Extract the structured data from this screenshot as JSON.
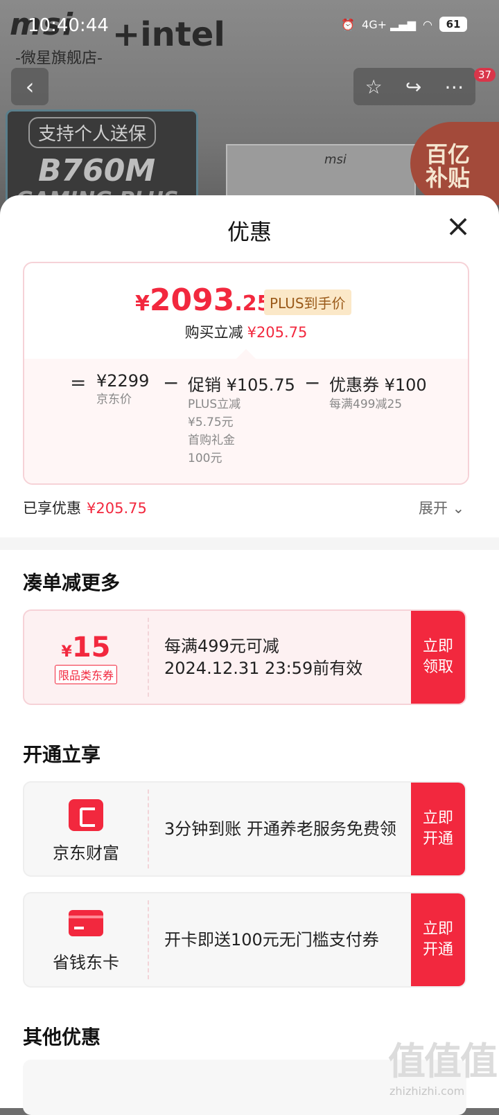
{
  "status": {
    "time": "10:40:44",
    "network": "4G+",
    "battery": "61"
  },
  "header": {
    "brand_msi": "msi",
    "brand_intel": "+intel",
    "store_name": "-微星旗舰店-",
    "back_label": "‹",
    "icons": [
      "star-icon",
      "share-icon",
      "more-icon"
    ],
    "badge_count": "37"
  },
  "hero": {
    "tag": "支持个人送保",
    "model": "B760M",
    "model_sub": "GAMING PLUS",
    "board_logo": "msi",
    "subsidy_line1": "百亿",
    "subsidy_line2": "补贴"
  },
  "sheet": {
    "title": "优惠",
    "close_label": "×",
    "price": {
      "symbol": "¥",
      "integer": "2093",
      "decimal": ".25",
      "plus_tag": "PLUS到手价",
      "reduce_label": "购买立减",
      "reduce_value": "¥205.75"
    },
    "formula": {
      "eq": "=",
      "base_value": "¥2299",
      "base_label": "京东价",
      "minus1": "−",
      "promo_value": "促销 ¥105.75",
      "promo_detail1": "PLUS立减",
      "promo_detail2": "¥5.75元",
      "promo_detail3": "首购礼金",
      "promo_detail4": "100元",
      "minus2": "−",
      "coupon_value": "优惠券 ¥100",
      "coupon_detail": "每满499减25"
    },
    "enjoyed_label": "已享优惠",
    "enjoyed_value": "¥205.75",
    "expand_label": "展开 ⌄"
  },
  "section_more": {
    "title": "凑单减更多",
    "coupon": {
      "symbol": "¥",
      "amount": "15",
      "tag": "限品类东券",
      "line1": "每满499元可减",
      "line2": "2024.12.31 23:59前有效",
      "btn_line1": "立即",
      "btn_line2": "领取"
    }
  },
  "section_open": {
    "title": "开通立享",
    "items": [
      {
        "name": "京东财富",
        "desc": "3分钟到账 开通养老服务免费领",
        "btn_line1": "立即",
        "btn_line2": "开通"
      },
      {
        "name": "省钱东卡",
        "desc": "开卡即送100元无门槛支付券",
        "btn_line1": "立即",
        "btn_line2": "开通"
      }
    ]
  },
  "section_other": {
    "title": "其他优惠"
  },
  "watermark": {
    "glyphs": "值值值",
    "url": "zhizhizhi.com"
  }
}
